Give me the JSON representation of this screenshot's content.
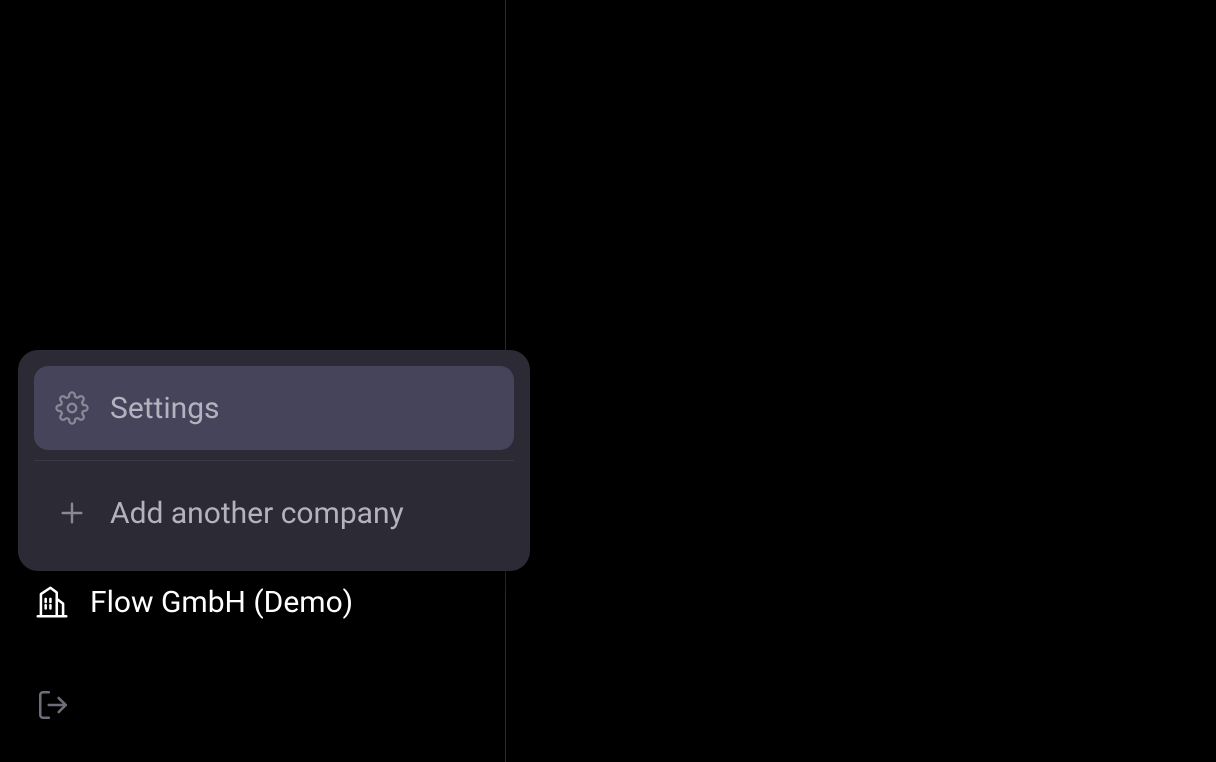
{
  "popup": {
    "settings_label": "Settings",
    "add_company_label": "Add another company"
  },
  "sidebar": {
    "company_name": "Flow GmbH (Demo)"
  },
  "colors": {
    "popup_bg": "#2b2a35",
    "popup_highlight": "#46445a",
    "text_muted": "#b5b2c0",
    "text_white": "#ffffff",
    "icon_stroke_muted": "#8a8896",
    "icon_stroke_white": "#ffffff",
    "icon_stroke_dim": "#6f6d7a"
  }
}
